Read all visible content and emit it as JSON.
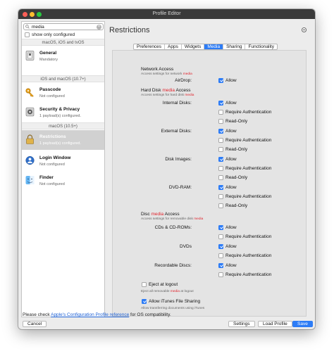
{
  "window": {
    "title": "Profile Editor"
  },
  "sidebar": {
    "search_value": "media",
    "show_only_configured": "show only configured",
    "sections": {
      "macos_ios_tvos": "macOS, iOS and tvOS",
      "ios_macos": "iOS and macOS (10.7+)",
      "macos": "macOS (10.5+)"
    },
    "items": [
      {
        "name": "General",
        "sub": "Mandatory",
        "icon": "gear-switch-icon"
      },
      {
        "name": "Passcode",
        "sub": "Not configured",
        "icon": "key-icon"
      },
      {
        "name": "Security & Privacy",
        "sub": "1 payload(s) configured.",
        "icon": "security-icon"
      },
      {
        "name": "Restrictions",
        "sub": "1 payload(s) configured.",
        "icon": "lock-icon"
      },
      {
        "name": "Login Window",
        "sub": "Not configured",
        "icon": "login-window-icon"
      },
      {
        "name": "Finder",
        "sub": "Not configured",
        "icon": "finder-icon"
      }
    ]
  },
  "main": {
    "title": "Restrictions",
    "tabs": [
      "Preferences",
      "Apps",
      "Widgets",
      "Media",
      "Sharing",
      "Functionality"
    ],
    "active_tab": "Media",
    "network": {
      "title": "Network Access",
      "desc_prefix": "Access settings for network ",
      "desc_highlight": "media",
      "airdrop_label": "AirDrop:",
      "allow": "Allow"
    },
    "harddisk": {
      "title_prefix": "Hard Disk ",
      "title_highlight": "media",
      "title_suffix": " Access",
      "desc_prefix": "Access settings for hard disk ",
      "desc_highlight": "media",
      "internal": "Internal Disks:",
      "external": "External Disks:",
      "images": "Disk Images:",
      "dvdram": "DVD-RAM:",
      "allow": "Allow",
      "require_auth": "Require Authentication",
      "read_only": "Read-Only"
    },
    "disc": {
      "title_prefix": "Disc ",
      "title_highlight": "media",
      "title_suffix": " Access",
      "desc_prefix": "Access settings for removable disk ",
      "desc_highlight": "media",
      "cds": "CDs & CD-ROMs:",
      "dvds": "DVDs",
      "recordable": "Recordable Discs:",
      "allow": "Allow",
      "require_auth": "Require Authentication"
    },
    "eject": {
      "label": "Eject at logout",
      "desc_prefix": "Eject all removable ",
      "desc_highlight": "media",
      "desc_suffix": " at logout"
    },
    "itunes": {
      "label": "Allow iTunes File Sharing",
      "desc": "Allow transferring documents using iTunes"
    }
  },
  "footer": {
    "compat_prefix": "Please check ",
    "compat_link": "Apple's Configuration Profile reference",
    "compat_suffix": " for OS compatibility.",
    "cancel": "Cancel",
    "settings": "Settings",
    "load_profile": "Load Profile",
    "save": "Save"
  },
  "colors": {
    "accent": "#2d7cf6",
    "highlight": "#e0242d",
    "titlebar": "#3a3a3a"
  }
}
